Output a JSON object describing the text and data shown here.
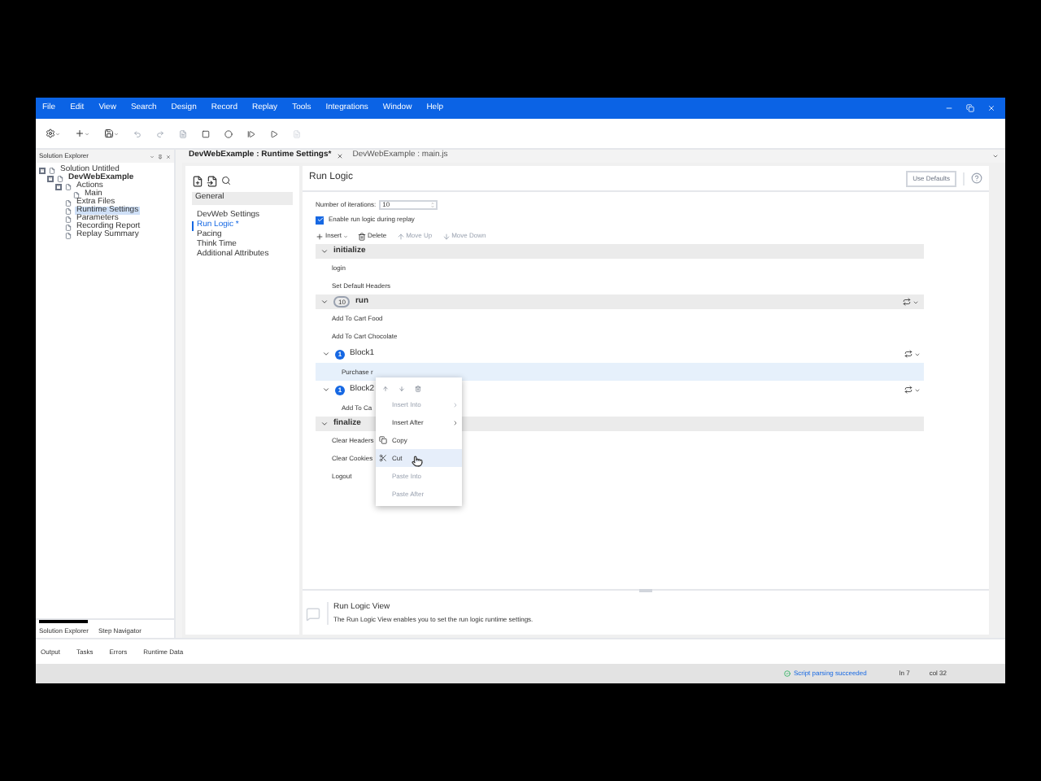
{
  "menu": [
    "File",
    "Edit",
    "View",
    "Search",
    "Design",
    "Record",
    "Replay",
    "Tools",
    "Integrations",
    "Window",
    "Help"
  ],
  "solution_explorer": {
    "title": "Solution Explorer",
    "tree": [
      {
        "label": "Solution Untitled",
        "expanded": true,
        "selected": false,
        "children": [
          {
            "label": "DevWebExample",
            "bold": true,
            "expanded": true,
            "selected": false,
            "children": [
              {
                "label": "Actions",
                "expanded": true,
                "selected": false,
                "children": [
                  {
                    "label": "Main",
                    "selected": false
                  }
                ]
              },
              {
                "label": "Extra Files",
                "selected": false
              },
              {
                "label": "Runtime Settings",
                "selected": true
              },
              {
                "label": "Parameters",
                "selected": false
              },
              {
                "label": "Recording Report",
                "selected": false
              },
              {
                "label": "Replay Summary",
                "selected": false
              }
            ]
          }
        ]
      }
    ],
    "tabs": [
      {
        "label": "Solution Explorer",
        "selected": true
      },
      {
        "label": "Step Navigator",
        "selected": false
      }
    ]
  },
  "editor_tabs": [
    {
      "label": "DevWebExample : Runtime Settings*",
      "selected": true
    },
    {
      "label": "DevWebExample : main.js",
      "selected": false
    }
  ],
  "settings_nav": {
    "header": "General",
    "items": [
      {
        "label": "DevWeb Settings",
        "selected": false
      },
      {
        "label": "Run Logic *",
        "selected": true
      },
      {
        "label": "Pacing",
        "selected": false
      },
      {
        "label": "Think Time",
        "selected": false
      },
      {
        "label": "Additional Attributes",
        "selected": false
      }
    ]
  },
  "run_logic": {
    "title": "Run Logic",
    "use_defaults": "Use Defaults",
    "iterations_label": "Number of iterations:",
    "iterations": "10",
    "enable_label": "Enable run logic during replay",
    "enabled": true,
    "actions": [
      {
        "kind": "insert",
        "label": "Insert",
        "disabled": false
      },
      {
        "kind": "delete",
        "label": "Delete",
        "disabled": false
      },
      {
        "kind": "up",
        "label": "Move Up",
        "disabled": true
      },
      {
        "kind": "down",
        "label": "Move Down",
        "disabled": true
      }
    ],
    "sections": [
      {
        "name": "initialize",
        "expanded": true,
        "items": [
          {
            "kind": "action",
            "label": "login",
            "selected": false
          },
          {
            "kind": "action",
            "label": "Set Default Headers",
            "selected": false
          }
        ]
      },
      {
        "name": "run",
        "count": "10",
        "expanded": true,
        "items": [
          {
            "kind": "action",
            "label": "Add To Cart Food",
            "selected": false
          },
          {
            "kind": "action",
            "label": "Add To Cart Chocolate",
            "selected": false
          },
          {
            "kind": "block",
            "label": "Block1",
            "count": "1",
            "expanded": true,
            "children": [
              {
                "kind": "action",
                "label": "Purchase r",
                "selected": true
              }
            ]
          },
          {
            "kind": "block",
            "label": "Block2",
            "count": "1",
            "expanded": true,
            "children": [
              {
                "kind": "action",
                "label": "Add To Ca",
                "selected": false
              }
            ]
          }
        ]
      },
      {
        "name": "finalize",
        "expanded": true,
        "items": [
          {
            "kind": "action",
            "label": "Clear Headers",
            "selected": false
          },
          {
            "kind": "action",
            "label": "Clear Cookies",
            "selected": false
          },
          {
            "kind": "action",
            "label": "Logout",
            "selected": false
          }
        ]
      }
    ]
  },
  "context_menu": {
    "items": [
      {
        "kind": "plain",
        "label": "Insert Into",
        "disabled": true,
        "submenu": true,
        "selected": false
      },
      {
        "kind": "plain",
        "label": "Insert After",
        "disabled": false,
        "submenu": true,
        "selected": false
      },
      {
        "kind": "copy",
        "label": "Copy",
        "disabled": false,
        "submenu": false,
        "selected": false
      },
      {
        "kind": "cut",
        "label": "Cut",
        "disabled": false,
        "submenu": false,
        "selected": true
      },
      {
        "kind": "plain",
        "label": "Paste Into",
        "disabled": true,
        "submenu": false,
        "selected": false
      },
      {
        "kind": "plain",
        "label": "Paste After",
        "disabled": true,
        "submenu": false,
        "selected": false
      }
    ]
  },
  "info": {
    "title": "Run Logic View",
    "text": "The Run Logic View enables you to set the run logic runtime settings."
  },
  "bottom_tabs": [
    "Output",
    "Tasks",
    "Errors",
    "Runtime Data"
  ],
  "status": {
    "message": "Script parsing succeeded",
    "line": "ln 7",
    "column": "col 32"
  }
}
